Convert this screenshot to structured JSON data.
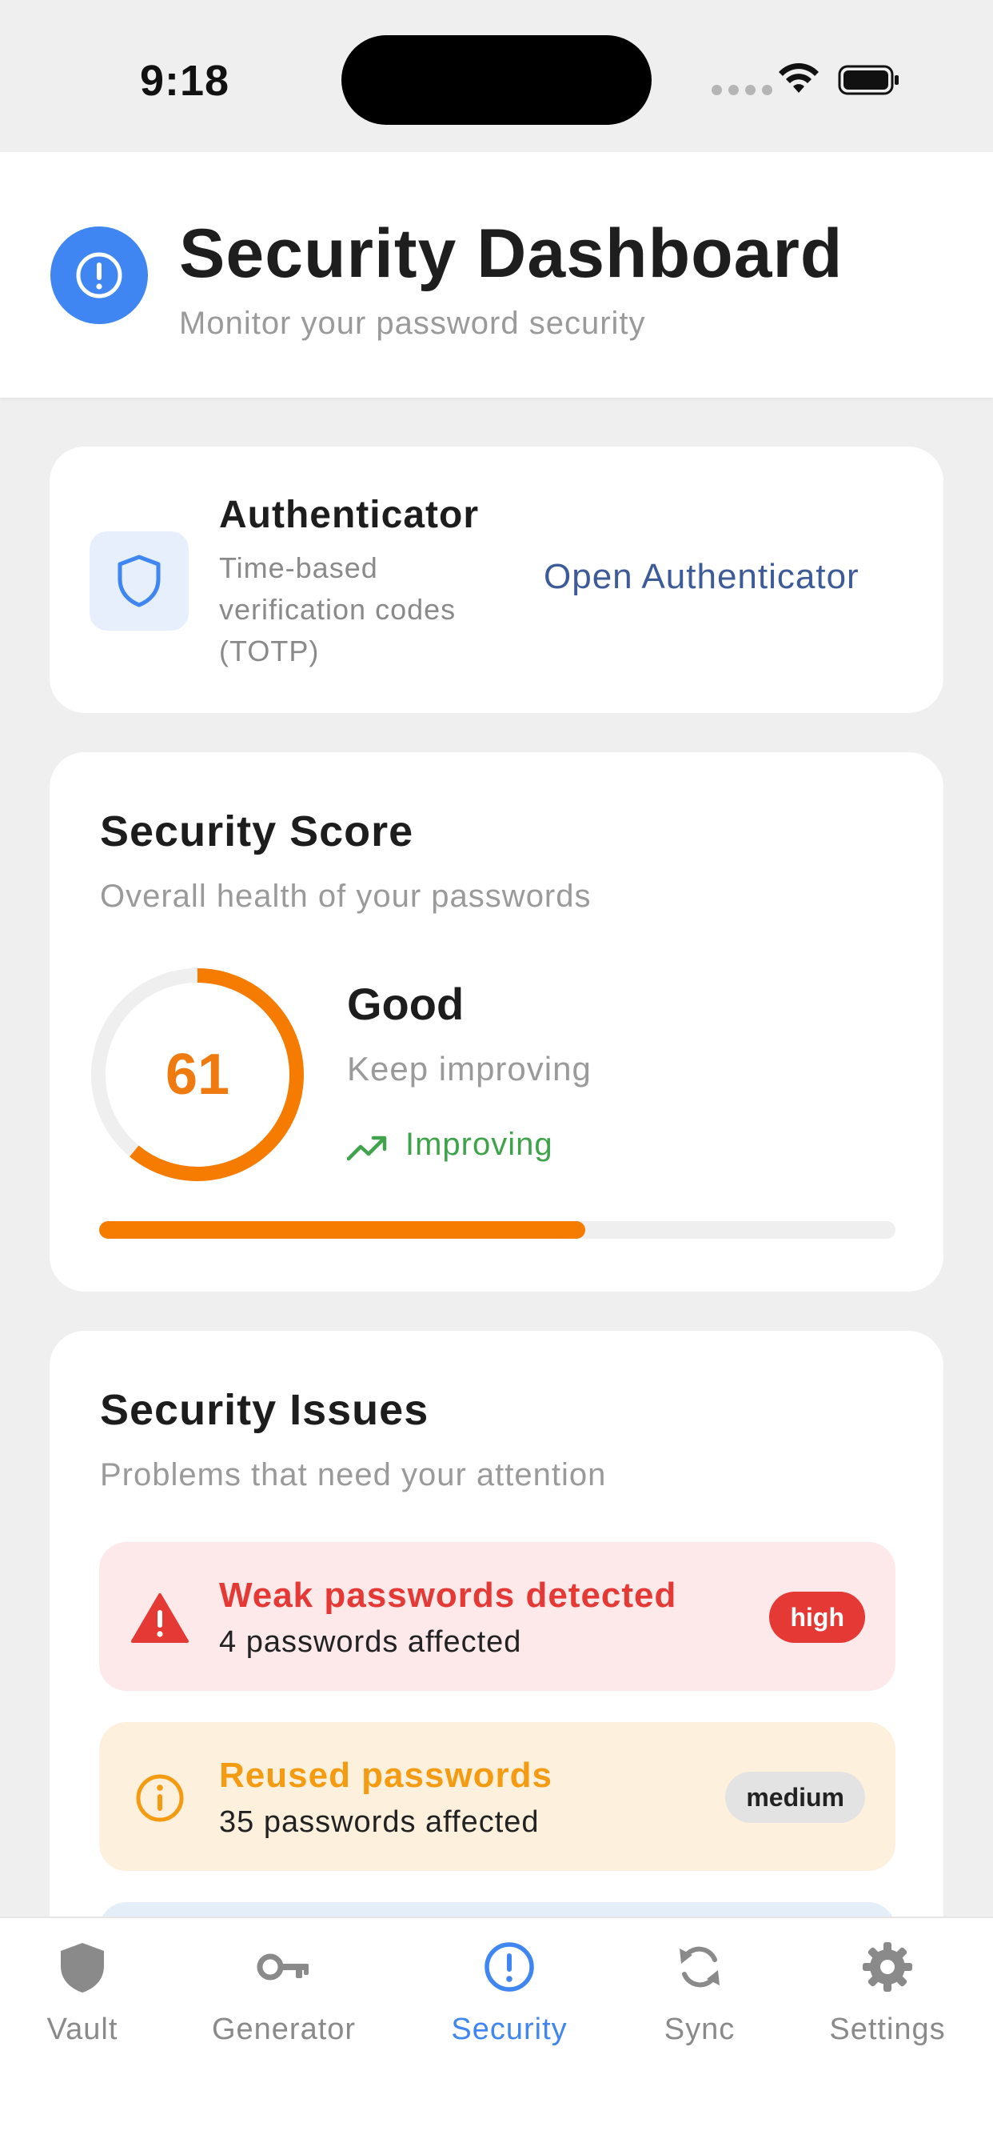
{
  "status_bar": {
    "time": "9:18"
  },
  "header": {
    "title": "Security Dashboard",
    "subtitle": "Monitor your password security"
  },
  "authenticator": {
    "title": "Authenticator",
    "description": "Time-based verification codes (TOTP)",
    "link_label": "Open Authenticator"
  },
  "score": {
    "title": "Security Score",
    "subtitle": "Overall health of your passwords",
    "value": "61",
    "percent": 61,
    "label": "Good",
    "hint": "Keep improving",
    "trend": "Improving",
    "accent_color": "#f57c00",
    "trend_color": "#3ea34a"
  },
  "issues": {
    "title": "Security Issues",
    "subtitle": "Problems that need your attention",
    "items": [
      {
        "title": "Weak passwords detected",
        "detail": "4 passwords affected",
        "severity": "high",
        "color": "#e53935",
        "icon": "warning-icon"
      },
      {
        "title": "Reused passwords",
        "detail": "35 passwords affected",
        "severity": "medium",
        "color": "#f59b12",
        "icon": "info-icon"
      }
    ]
  },
  "tabbar": {
    "active": "Security",
    "tabs": [
      {
        "label": "Vault",
        "icon": "shield-icon"
      },
      {
        "label": "Generator",
        "icon": "key-icon"
      },
      {
        "label": "Security",
        "icon": "alert-circle-icon"
      },
      {
        "label": "Sync",
        "icon": "sync-icon"
      },
      {
        "label": "Settings",
        "icon": "gear-icon"
      }
    ]
  },
  "colors": {
    "primary": "#3f86f3",
    "background": "#efefef"
  }
}
